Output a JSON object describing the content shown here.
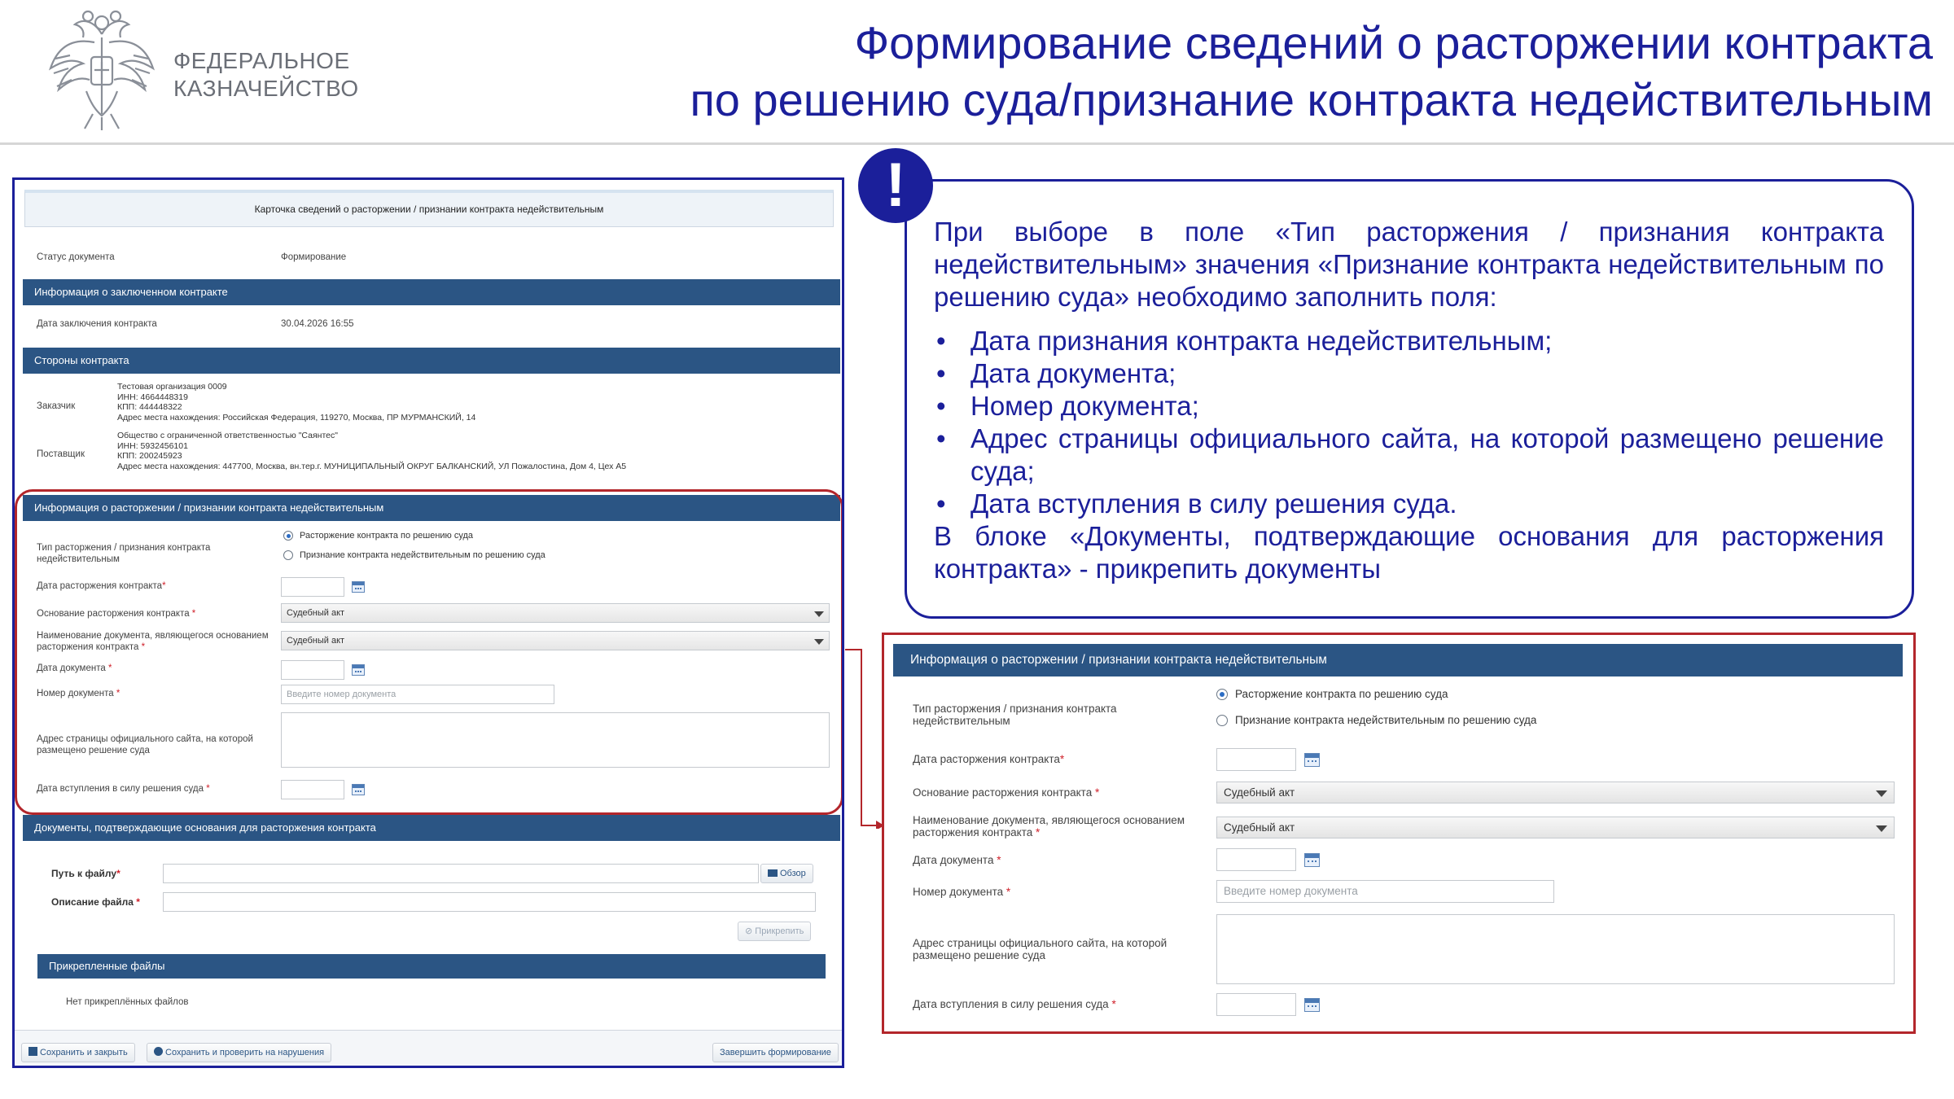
{
  "header": {
    "org_line1": "ФЕДЕРАЛЬНОЕ",
    "org_line2": "КАЗНАЧЕЙСТВО",
    "title_line1": "Формирование сведений о расторжении контракта",
    "title_line2": "по решению суда/признание контракта недействительным",
    "emblem_icon": "double-headed-eagle-emblem"
  },
  "colors": {
    "title": "#1b1f9a",
    "section_bar": "#2b5584",
    "highlight": "#b3262b",
    "required": "#d0202a"
  },
  "form": {
    "card_title": "Карточка сведений о расторжении / признании контракта недействительным",
    "status_label": "Статус документа",
    "status_value": "Формирование",
    "contract_section": "Информация о заключенном контракте",
    "conclusion_date_label": "Дата заключения контракта",
    "conclusion_date_value": "30.04.2026 16:55",
    "parties_section": "Стороны контракта",
    "customer_label": "Заказчик",
    "customer_lines": [
      "Тестовая организация 0009",
      "ИНН: 4664448319",
      "КПП: 444448322",
      "Адрес места нахождения: Российская Федерация, 119270, Москва, ПР МУРМАНСКИЙ, 14"
    ],
    "supplier_label": "Поставщик",
    "supplier_lines": [
      "Общество с ограниченной ответственностью \"Саянтес\"",
      "ИНН: 5932456101",
      "КПП: 200245923",
      "Адрес места нахождения: 447700, Москва, вн.тер.г. МУНИЦИПАЛЬНЫЙ ОКРУГ БАЛКАНСКИЙ, УЛ Пожалостина, Дом 4, Цех А5"
    ],
    "termination_section": "Информация о расторжении / признании контракта недействительным",
    "type_label": "Тип расторжения / признания контракта недействительным",
    "type_label_line1": "Тип расторжения / признания контракта",
    "type_label_line2": "недействительным",
    "type_option1": "Расторжение контракта по решению суда",
    "type_option2": "Признание контракта недействительным по решению суда",
    "termination_date_label": "Дата расторжения контракта",
    "basis_label": "Основание расторжения контракта ",
    "basis_value": "Судебный акт",
    "docname_label_line1": "Наименование документа, являющегося основанием",
    "docname_label_line2": "расторжения контракта ",
    "docname_value": "Судебный акт",
    "doc_date_label": "Дата документа ",
    "doc_number_label": "Номер документа ",
    "doc_number_placeholder": "Введите номер документа",
    "url_label_line1": "Адрес страницы официального сайта, на которой",
    "url_label_line2": "размещено решение суда",
    "effective_date_label": "Дата вступления в силу решения суда ",
    "required_mark": "*",
    "documents_section": "Документы, подтверждающие основания для расторжения контракта",
    "file_path_label": "Путь к файлу",
    "browse_button": "Обзор",
    "file_desc_label": "Описание файла ",
    "attach_button": "Прикрепить",
    "attached_section": "Прикрепленные файлы",
    "no_files_text": "Нет прикреплённых файлов",
    "save_close_button": "Сохранить и закрыть",
    "save_check_button": "Сохранить и проверить на нарушения",
    "finish_button": "Завершить формирование"
  },
  "callout": {
    "exclamation": "!",
    "intro": "При выборе в поле «Тип расторжения / признания контракта недействительным» значения «Признание контракта недействительным по решению суда» необходимо заполнить поля:",
    "items": [
      "Дата признания контракта недействительным;",
      "Дата документа;",
      "Номер документа;",
      "Адрес страницы официального сайта, на которой размещено решение суда;",
      "Дата вступления в силу решения суда."
    ],
    "outro": "В блоке «Документы, подтверждающие основания для расторжения контракта» - прикрепить документы"
  }
}
